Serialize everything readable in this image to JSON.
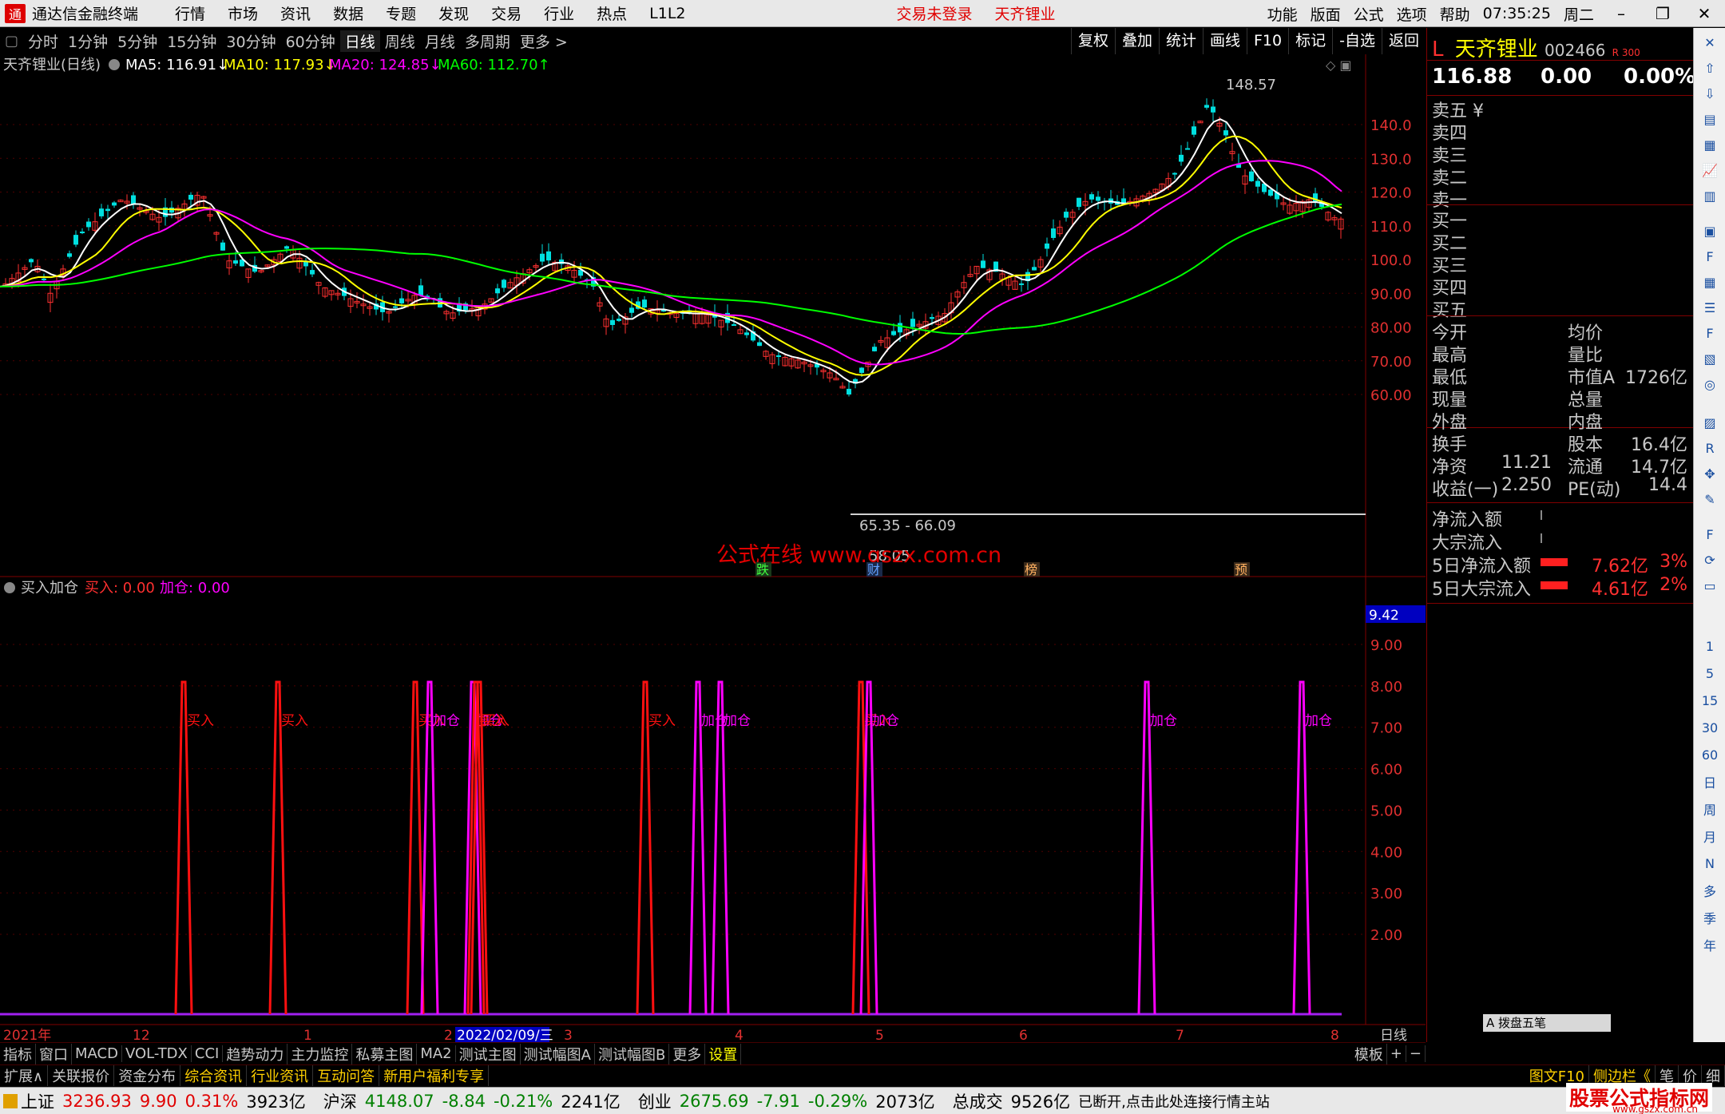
{
  "menubar": {
    "app_title": "通达信金融终端",
    "items": [
      "行情",
      "市场",
      "资讯",
      "数据",
      "专题",
      "发现",
      "交易",
      "行业",
      "热点",
      "L1L2"
    ],
    "login_status": "交易未登录",
    "stock_name_red": "天齐锂业",
    "right_items": [
      "功能",
      "版面",
      "公式",
      "选项",
      "帮助"
    ],
    "time": "07:35:25",
    "weekday": "周二"
  },
  "periodbar": {
    "items": [
      "分时",
      "1分钟",
      "5分钟",
      "15分钟",
      "30分钟",
      "60分钟",
      "日线",
      "周线",
      "月线",
      "多周期",
      "更多 >"
    ],
    "active": "日线",
    "tools": [
      "复权",
      "叠加",
      "统计",
      "画线",
      "F10",
      "标记",
      "-自选",
      "返回"
    ]
  },
  "main_chart": {
    "title": "天齐锂业(日线)",
    "ma_labels": [
      {
        "text": "MA5: 116.91↓",
        "color": "#ffffff"
      },
      {
        "text": "MA10: 117.93↓",
        "color": "#ffff00"
      },
      {
        "text": "MA20: 124.85↓",
        "color": "#ff00ff"
      },
      {
        "text": "MA60: 112.70↑",
        "color": "#00ff00"
      }
    ],
    "y_ticks": [
      "140.0",
      "130.0",
      "120.0",
      "110.0",
      "100.0",
      "90.00",
      "80.00",
      "70.00",
      "60.00"
    ],
    "high_label": "148.57",
    "low_label": "58.05",
    "range_label": "65.35 - 66.09",
    "watermark": "公式在线  www.gszx.com.cn",
    "event_marks": [
      "跌",
      "财",
      "榜",
      "预"
    ]
  },
  "indicator": {
    "title": "买入加仓",
    "buy_label": "买入: 0.00",
    "add_label": "加仓: 0.00",
    "current_value": "9.42",
    "y_ticks": [
      "9.00",
      "8.00",
      "7.00",
      "6.00",
      "5.00",
      "4.00",
      "3.00",
      "2.00"
    ],
    "signals": [
      {
        "type": "buy",
        "label": "买入"
      },
      {
        "type": "buy",
        "label": "买入"
      },
      {
        "type": "buy",
        "label": "买入"
      },
      {
        "type": "add",
        "label": "加仓"
      },
      {
        "type": "add",
        "label": "加仓"
      },
      {
        "type": "buy",
        "label": "买入"
      },
      {
        "type": "buy",
        "label": "买入"
      },
      {
        "type": "add",
        "label": "加仓"
      },
      {
        "type": "add",
        "label": "加仓"
      },
      {
        "type": "buy",
        "label": "买入"
      },
      {
        "type": "add",
        "label": "加仓"
      },
      {
        "type": "add",
        "label": "加仓"
      },
      {
        "type": "add",
        "label": "加仓"
      },
      {
        "type": "buy",
        "label": "买入"
      }
    ]
  },
  "time_axis": {
    "labels": [
      "2021年",
      "12",
      "1",
      "2",
      "2022/02/09/三",
      "3",
      "4",
      "5",
      "6",
      "7",
      "8"
    ],
    "period": "日线"
  },
  "right_panel": {
    "code_prefix": "L",
    "name": "天齐锂业",
    "code": "002466",
    "badge": "R 300",
    "price": "116.88",
    "change": "0.00",
    "pct": "0.00%",
    "asks": [
      "卖五 ¥",
      "卖四",
      "卖三",
      "卖二",
      "卖一"
    ],
    "bids": [
      "买一",
      "买二",
      "买三",
      "买四",
      "买五"
    ],
    "stats": [
      {
        "l": "今开",
        "v": "",
        "l2": "均价",
        "v2": ""
      },
      {
        "l": "最高",
        "v": "",
        "l2": "量比",
        "v2": ""
      },
      {
        "l": "最低",
        "v": "",
        "l2": "市值A",
        "v2": "1726亿"
      },
      {
        "l": "现量",
        "v": "",
        "l2": "总量",
        "v2": ""
      },
      {
        "l": "外盘",
        "v": "",
        "l2": "内盘",
        "v2": ""
      }
    ],
    "stats2": [
      {
        "l": "换手",
        "v": "",
        "l2": "股本",
        "v2": "16.4亿"
      },
      {
        "l": "净资",
        "v": "11.21",
        "l2": "流通",
        "v2": "14.7亿"
      },
      {
        "l": "收益(一)",
        "v": "2.250",
        "l2": "PE(动)",
        "v2": "14.4"
      }
    ],
    "flows": [
      {
        "l": "净流入额",
        "v": "",
        "p": ""
      },
      {
        "l": "大宗流入",
        "v": "",
        "p": ""
      },
      {
        "l": "5日净流入额",
        "v": "7.62亿",
        "p": "3%"
      },
      {
        "l": "5日大宗流入",
        "v": "4.61亿",
        "p": "2%"
      }
    ],
    "mini_tab": "A 拨盘五笔"
  },
  "side_icons": [
    "1",
    "5",
    "15",
    "30",
    "60",
    "日",
    "周",
    "月",
    "N",
    "多",
    "季",
    "年"
  ],
  "bottom_tabs1": [
    "指标",
    "窗口",
    "MACD",
    "VOL-TDX",
    "CCI",
    "趋势动力",
    "主力监控",
    "私募主图",
    "MA2",
    "测试主图",
    "测试幅图A",
    "测试幅图B",
    "更多",
    "设置",
    "模板",
    "+",
    "−"
  ],
  "bottom_tabs2": [
    "扩展∧",
    "关联报价",
    "资金分布",
    "综合资讯",
    "行业资讯",
    "互动问答",
    "新用户福利专享"
  ],
  "bottom_right": [
    "图文F10",
    "侧边栏《",
    "笔",
    "价",
    "细"
  ],
  "statusbar": {
    "sh": {
      "name": "上证",
      "price": "3236.93",
      "chg": "9.90",
      "pct": "0.31%",
      "amt": "3923亿"
    },
    "sz": {
      "name": "沪深",
      "price": "4148.07",
      "chg": "-8.84",
      "pct": "-0.21%",
      "amt": "2241亿"
    },
    "cy": {
      "name": "创业",
      "price": "2675.69",
      "chg": "-7.91",
      "pct": "-0.29%",
      "amt": "2073亿"
    },
    "total_label": "总成交",
    "total": "9526亿",
    "msg": "已断开,点击此处连接行情主站",
    "brand": "股票公式指标网",
    "brand_url": "www.gszx.com.cn"
  }
}
